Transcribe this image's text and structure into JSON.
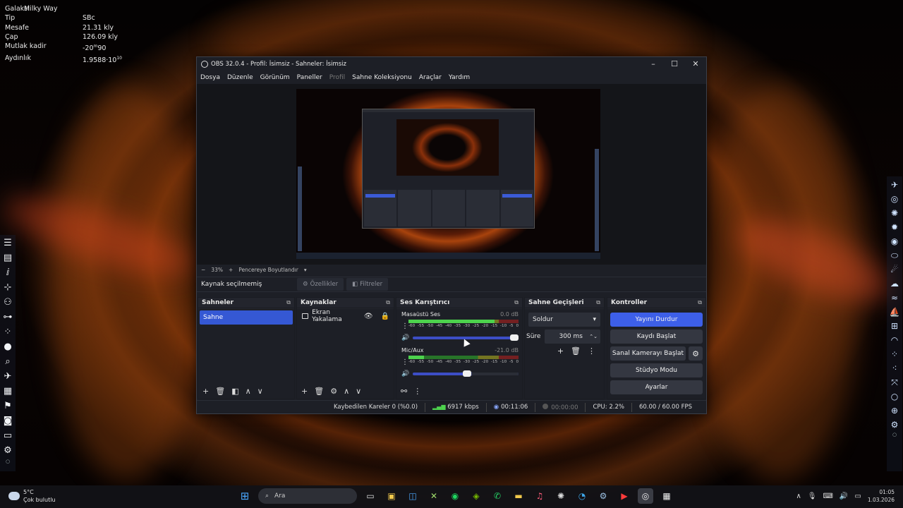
{
  "info_panel": [
    {
      "key": "Galaksi",
      "value": "Milky Way"
    },
    {
      "key": "Tip",
      "value": "SBc"
    },
    {
      "key": "Mesafe",
      "value": "21.31 kly"
    },
    {
      "key": "Çap",
      "value": "126.09 kly"
    },
    {
      "key": "Mutlak kadir",
      "value": "-20m90"
    },
    {
      "key": "Aydınlık",
      "value": "1.9588·10^10"
    }
  ],
  "window": {
    "title": "OBS 32.0.4 - Profil: İsimsiz - Sahneler: İsimsiz",
    "menu": [
      "Dosya",
      "Düzenle",
      "Görünüm",
      "Paneller",
      "Profil",
      "Sahne Koleksiyonu",
      "Araçlar",
      "Yardım"
    ],
    "menu_disabled": "Profil"
  },
  "preview": {
    "zoom": "33%",
    "zoom_mode": "Pencereye Boyutlandır",
    "no_source": "Kaynak seçilmemiş",
    "props_label": "Özellikler",
    "filters_label": "Filtreler"
  },
  "docks": {
    "scenes": {
      "title": "Sahneler",
      "items": [
        "Sahne"
      ]
    },
    "sources": {
      "title": "Kaynaklar",
      "items": [
        "Ekran Yakalama"
      ]
    },
    "mixer": {
      "title": "Ses Karıştırıcı",
      "ticks": [
        "-60",
        "-55",
        "-50",
        "-45",
        "-40",
        "-35",
        "-30",
        "-25",
        "-20",
        "-15",
        "-10",
        "-5",
        "0"
      ],
      "channels": [
        {
          "name": "Masaüstü Ses",
          "db": "0.0 dB",
          "level": 0.78,
          "volume": 1.0
        },
        {
          "name": "Mic/Aux",
          "db": "-21.0 dB",
          "level": 0.14,
          "volume": 0.55
        }
      ]
    },
    "transitions": {
      "title": "Sahne Geçişleri",
      "selected": "Soldur",
      "duration_label": "Süre",
      "duration": "300 ms"
    },
    "controls": {
      "title": "Kontroller",
      "stop_stream": "Yayını Durdur",
      "start_record": "Kaydı Başlat",
      "virtual_cam": "Sanal Kamerayı Başlat",
      "studio_mode": "Stüdyo Modu",
      "settings": "Ayarlar"
    }
  },
  "status": {
    "dropped": "Kaybedilen Kareler 0 (%0.0)",
    "bitrate": "6917 kbps",
    "stream_time": "00:11:06",
    "record_time": "00:00:00",
    "cpu": "CPU: 2.2%",
    "fps": "60.00 / 60.00 FPS"
  },
  "taskbar": {
    "temp": "5°C",
    "weather": "Çok bulutlu",
    "search_placeholder": "Ara",
    "time": "01:05",
    "date": "1.03.2026"
  }
}
